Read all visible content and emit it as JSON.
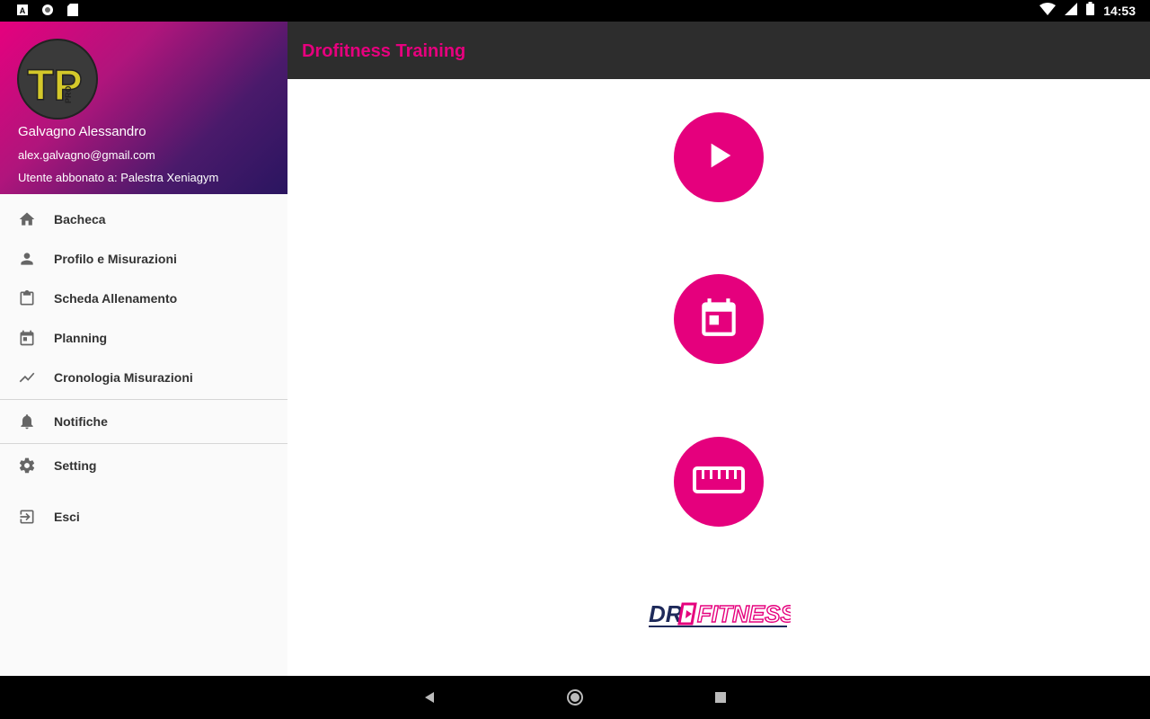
{
  "status_bar": {
    "time": "14:53",
    "left_icons": [
      "notification-a-icon",
      "circle-icon",
      "sd-card-icon"
    ],
    "right_icons": [
      "wifi-icon",
      "signal-icon",
      "battery-icon"
    ]
  },
  "drawer": {
    "header": {
      "avatar_text": "TP",
      "avatar_sub": "PRO",
      "name": "Galvagno Alessandro",
      "email": "alex.galvagno@gmail.com",
      "subscription": "Utente abbonato a: Palestra Xeniagym",
      "gradient": [
        "#e6007e",
        "#2a1560"
      ]
    },
    "items": [
      {
        "label": "Bacheca",
        "icon": "home-icon"
      },
      {
        "label": "Profilo e Misurazioni",
        "icon": "person-icon"
      },
      {
        "label": "Scheda Allenamento",
        "icon": "clipboard-icon"
      },
      {
        "label": "Planning",
        "icon": "calendar-icon"
      },
      {
        "label": "Cronologia Misurazioni",
        "icon": "trending-icon"
      },
      {
        "label": "Notifiche",
        "icon": "bell-icon"
      },
      {
        "label": "Setting",
        "icon": "gear-icon"
      },
      {
        "label": "Esci",
        "icon": "exit-icon"
      }
    ]
  },
  "app_bar": {
    "title": "Drofitness Training",
    "title_color": "#e6007e",
    "background": "#2d2d2d"
  },
  "main": {
    "buttons": [
      {
        "name": "play-button",
        "icon": "play-icon"
      },
      {
        "name": "calendar-button",
        "icon": "calendar-icon"
      },
      {
        "name": "ruler-button",
        "icon": "ruler-icon"
      }
    ],
    "accent": "#e5007d",
    "logo_text_left": "DR",
    "logo_text_right": "FITNESS"
  },
  "nav_bar": {
    "buttons": [
      "back-icon",
      "home-icon",
      "recents-icon"
    ]
  }
}
